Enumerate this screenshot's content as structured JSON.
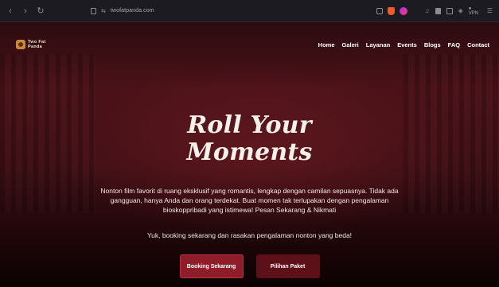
{
  "browser": {
    "url": "twofatpanda.com",
    "vpn_label": "● VPN"
  },
  "header": {
    "logo_line1": "Two Fat",
    "logo_line2": "Panda",
    "nav": [
      "Home",
      "Galeri",
      "Layanan",
      "Events",
      "Blogs",
      "FAQ",
      "Contact"
    ]
  },
  "hero": {
    "title_line1": "Roll Your",
    "title_line2": "Moments",
    "description": "Nonton film favorit di ruang eksklusif yang romantis, lengkap dengan camilan sepuasnya. Tidak ada gangguan, hanya Anda dan orang terdekat. Buat momen tak terlupakan dengan pengalaman bioskoppribadi yang istimewa! Pesan Sekarang & Nikmati",
    "subtext": "Yuk, booking sekarang dan rasakan pengalaman nonton yang beda!",
    "primary_button": "Booking Sekarang",
    "secondary_button": "Pilihan Paket"
  },
  "colors": {
    "accent": "#8e1d29",
    "secondary": "#5e1019",
    "background": "#3d0f14"
  }
}
